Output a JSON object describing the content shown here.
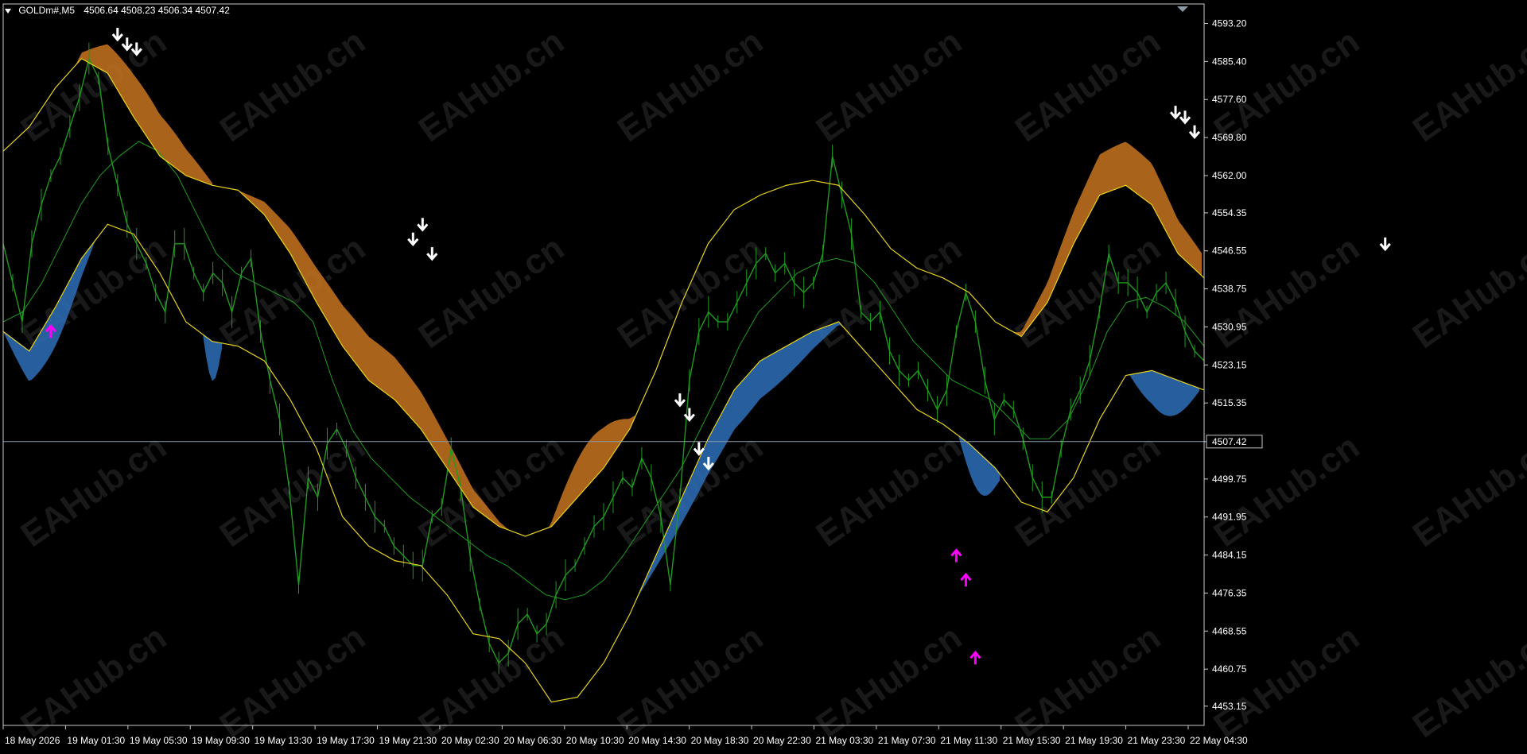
{
  "header": {
    "symbol": "GOLDm#,M5",
    "ohlc": "4506.64 4508.23 4506.34 4507.42"
  },
  "watermark": "EAHub.cn",
  "current_price": "4507.42",
  "colors": {
    "background": "#000000",
    "price": "#1f9a1f",
    "envelope": "#e6d21e",
    "bear_fill": "#c8741e",
    "bull_fill": "#2e6fb8",
    "buy_arrow": "#ff00ff",
    "sell_arrow": "#ffffff",
    "axis": "#ffffff",
    "price_line": "#8c9aa6"
  },
  "chart_data": {
    "type": "line",
    "title": "GOLDm#,M5",
    "ylim": [
      4449.2,
      4597.2
    ],
    "y_ticks": [
      "4593.20",
      "4585.40",
      "4577.60",
      "4569.80",
      "4562.00",
      "4554.35",
      "4546.55",
      "4538.75",
      "4530.95",
      "4523.15",
      "4515.35",
      "4507.42",
      "4499.75",
      "4491.95",
      "4484.15",
      "4476.35",
      "4468.55",
      "4460.75",
      "4453.15"
    ],
    "x_ticks": [
      "18 May 2026",
      "19 May 01:30",
      "19 May 05:30",
      "19 May 09:30",
      "19 May 13:30",
      "19 May 17:30",
      "19 May 21:30",
      "20 May 02:30",
      "20 May 06:30",
      "20 May 10:30",
      "20 May 14:30",
      "20 May 18:30",
      "20 May 22:30",
      "21 May 03:30",
      "21 May 07:30",
      "21 May 11:30",
      "21 May 15:30",
      "21 May 19:30",
      "21 May 23:30",
      "22 May 04:30"
    ],
    "series": [
      {
        "values": [
          4548.0,
          4540.0,
          4532.0,
          4548.0,
          4556.0,
          4562.0,
          4566.0,
          4572.0,
          4578.0,
          4586.0,
          4582.0,
          4568.0,
          4560.0,
          4552.0,
          4548.0,
          4544.0,
          4538.0,
          4534.0,
          4548.0,
          4548.0,
          4542.0,
          4538.0,
          4542.0,
          4540.0,
          4534.0,
          4542.0,
          4545.0,
          4530.0,
          4520.0,
          4512.0,
          4498.0,
          4478.0,
          4500.0,
          4496.0,
          4507.0,
          4510.0,
          4506.0,
          4500.0,
          4496.0,
          4492.0,
          4490.0,
          4486.0,
          4484.0,
          4482.0,
          4482.0,
          4492.0,
          4494.0,
          4506.0,
          4498.0,
          4484.0,
          4474.0,
          4466.0,
          4462.0,
          4464.0,
          4470.0,
          4472.0,
          4468.0,
          4470.0,
          4476.0,
          4480.0,
          4482.0,
          4486.0,
          4490.0,
          4492.0,
          4496.0,
          4500.0,
          4498.0,
          4504.0,
          4500.0,
          4492.0,
          4478.0,
          4496.0,
          4520.0,
          4530.0,
          4534.0,
          4532.0,
          4532.0,
          4536.0,
          4540.0,
          4544.0,
          4546.0,
          4542.0,
          4544.0,
          4540.0,
          4538.0,
          4540.0,
          4546.0,
          4566.0,
          4558.0,
          4550.0,
          4534.0,
          4532.0,
          4534.0,
          4526.0,
          4522.0,
          4520.0,
          4522.0,
          4518.0,
          4514.0,
          4518.0,
          4530.0,
          4538.0,
          4532.0,
          4520.0,
          4512.0,
          4516.0,
          4514.0,
          4508.0,
          4500.0,
          4496.0,
          4496.0,
          4506.0,
          4514.0,
          4518.0,
          4524.0,
          4534.0,
          4546.0,
          4540.0,
          4540.0,
          4538.0,
          4534.0,
          4538.0,
          4540.0,
          4536.0,
          4530.0,
          4526.0,
          4524.0
        ]
      },
      {
        "values": [
          4532.0,
          4534.0,
          4540.0,
          4548.0,
          4556.0,
          4562.0,
          4566.0,
          4569.0,
          4567.0,
          4562.0,
          4554.0,
          4546.0,
          4542.0,
          4540.0,
          4538.0,
          4536.0,
          4532.0,
          4520.0,
          4510.0,
          4504.0,
          4500.0,
          4496.0,
          4493.0,
          4490.0,
          4487.0,
          4484.0,
          4482.0,
          4479.0,
          4476.0,
          4475.0,
          4476.0,
          4479.0,
          4484.0,
          4490.0,
          4496.0,
          4502.0,
          4510.0,
          4518.0,
          4527.0,
          4534.0,
          4538.0,
          4542.0,
          4544.0,
          4545.0,
          4544.0,
          4540.0,
          4534.0,
          4528.0,
          4524.0,
          4520.0,
          4518.0,
          4516.0,
          4512.0,
          4508.0,
          4508.0,
          4512.0,
          4520.0,
          4530.0,
          4536.0,
          4537.0,
          4535.0,
          4532.0,
          4527.0
        ]
      },
      {
        "values": [
          4567.0,
          4572.0,
          4580.0,
          4586.0,
          4583.0,
          4574.0,
          4566.0,
          4562.0,
          4560.0,
          4559.0,
          4554.0,
          4546.0,
          4536.0,
          4527.0,
          4520.0,
          4516.0,
          4510.0,
          4502.0,
          4494.0,
          4490.0,
          4488.0,
          4490.0,
          4496.0,
          4502.0,
          4510.0,
          4522.0,
          4536.0,
          4548.0,
          4555.0,
          4558.0,
          4560.0,
          4561.0,
          4560.0,
          4554.0,
          4547.0,
          4543.0,
          4541.0,
          4538.0,
          4532.0,
          4529.0,
          4536.0,
          4548.0,
          4558.0,
          4560.0,
          4556.0,
          4546.0,
          4541.0
        ]
      },
      {
        "values": [
          4530.0,
          4526.0,
          4535.0,
          4545.0,
          4552.0,
          4550.0,
          4542.0,
          4532.0,
          4528.0,
          4527.0,
          4524.0,
          4516.0,
          4506.0,
          4492.0,
          4486.0,
          4483.0,
          4482.0,
          4476.0,
          4468.0,
          4467.0,
          4462.0,
          4454.0,
          4455.0,
          4462.0,
          4472.0,
          4484.0,
          4496.0,
          4508.0,
          4518.0,
          4524.0,
          4527.0,
          4530.0,
          4532.0,
          4526.0,
          4520.0,
          4514.0,
          4511.0,
          4507.0,
          4502.0,
          4495.0,
          4493.0,
          4500.0,
          4512.0,
          4521.0,
          4522.0,
          4520.0,
          4518.0
        ]
      }
    ],
    "buy_signals": [
      [
        5,
        4530.0
      ],
      [
        100,
        4484.0
      ],
      [
        101,
        4479.0
      ],
      [
        102,
        4463.0
      ]
    ],
    "sell_signals": [
      [
        12,
        4591.0
      ],
      [
        13,
        4589.0
      ],
      [
        14,
        4588.0
      ],
      [
        43,
        4549.0
      ],
      [
        44,
        4552.0
      ],
      [
        45,
        4546.0
      ],
      [
        71,
        4516.0
      ],
      [
        72,
        4513.0
      ],
      [
        73,
        4506.0
      ],
      [
        74,
        4503.0
      ],
      [
        123,
        4575.0
      ],
      [
        124,
        4574.0
      ],
      [
        125,
        4571.0
      ],
      [
        145,
        4548.0
      ]
    ]
  }
}
